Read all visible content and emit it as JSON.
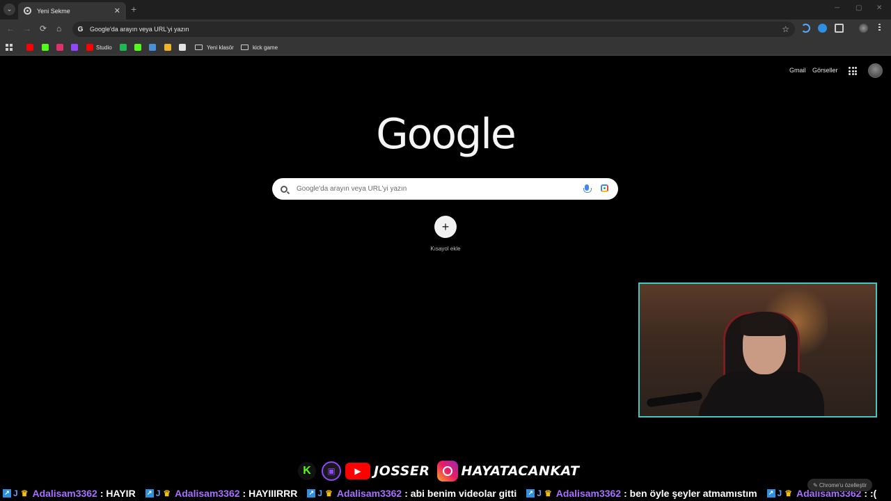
{
  "browser": {
    "tab": {
      "title": "Yeni Sekme",
      "close_glyph": "✕"
    },
    "new_tab_glyph": "+",
    "tab_menu_glyph": "⌄",
    "window_controls": [
      "─",
      "▢",
      "✕"
    ],
    "nav": {
      "back": "←",
      "forward": "→",
      "reload": "⟳",
      "home": "⌂"
    },
    "omnibox": {
      "text": "Google'da arayın veya URL'yi yazın",
      "g_glyph": "G"
    },
    "bookmark_star": "☆",
    "bookmarks": [
      {
        "icon": "youtube-icon",
        "label": "",
        "color": "#ff0000"
      },
      {
        "icon": "kick-icon",
        "label": "",
        "color": "#53fc18"
      },
      {
        "icon": "instagram-icon",
        "label": "",
        "color": "#e1306c"
      },
      {
        "icon": "twitch-icon",
        "label": "",
        "color": "#9146ff"
      },
      {
        "icon": "youtube-studio-icon",
        "label": "Studio",
        "color": "#ff0000"
      },
      {
        "icon": "spotify-icon",
        "label": "",
        "color": "#1db954"
      },
      {
        "icon": "kick-icon",
        "label": "",
        "color": "#53fc18"
      },
      {
        "icon": "bookmark-app-icon",
        "label": "",
        "color": "#4a90d9"
      },
      {
        "icon": "bookmark-app-icon",
        "label": "",
        "color": "#f0b429"
      },
      {
        "icon": "bookmark-app-icon",
        "label": "",
        "color": "#e3e3e3"
      }
    ],
    "folders": [
      "Yeni klasör",
      "kick game"
    ]
  },
  "google": {
    "links": {
      "gmail": "Gmail",
      "images": "Görseller"
    },
    "logo": "Google",
    "search_placeholder": "Google'da arayın veya URL'yi yazın",
    "shortcut_add_glyph": "+",
    "shortcut_add_label": "Kısayol ekle",
    "customize": "✎ Chrome'u özelleştir"
  },
  "stream_overlay": {
    "socials": {
      "kick_glyph": "K",
      "youtube_name": "JOSSER",
      "instagram_name": "HAYATACANKAT"
    },
    "chat": [
      {
        "user": "Adalisam3362",
        "text": ": HAYIR"
      },
      {
        "user": "Adalisam3362",
        "text": ": HAYIIIRRR"
      },
      {
        "user": "Adalisam3362",
        "text": ": abi benim videolar gitti"
      },
      {
        "user": "Adalisam3362",
        "text": ": ben öyle şeyler atmamıstım"
      },
      {
        "user": "Adalisam3362",
        "text": ": :("
      }
    ]
  }
}
